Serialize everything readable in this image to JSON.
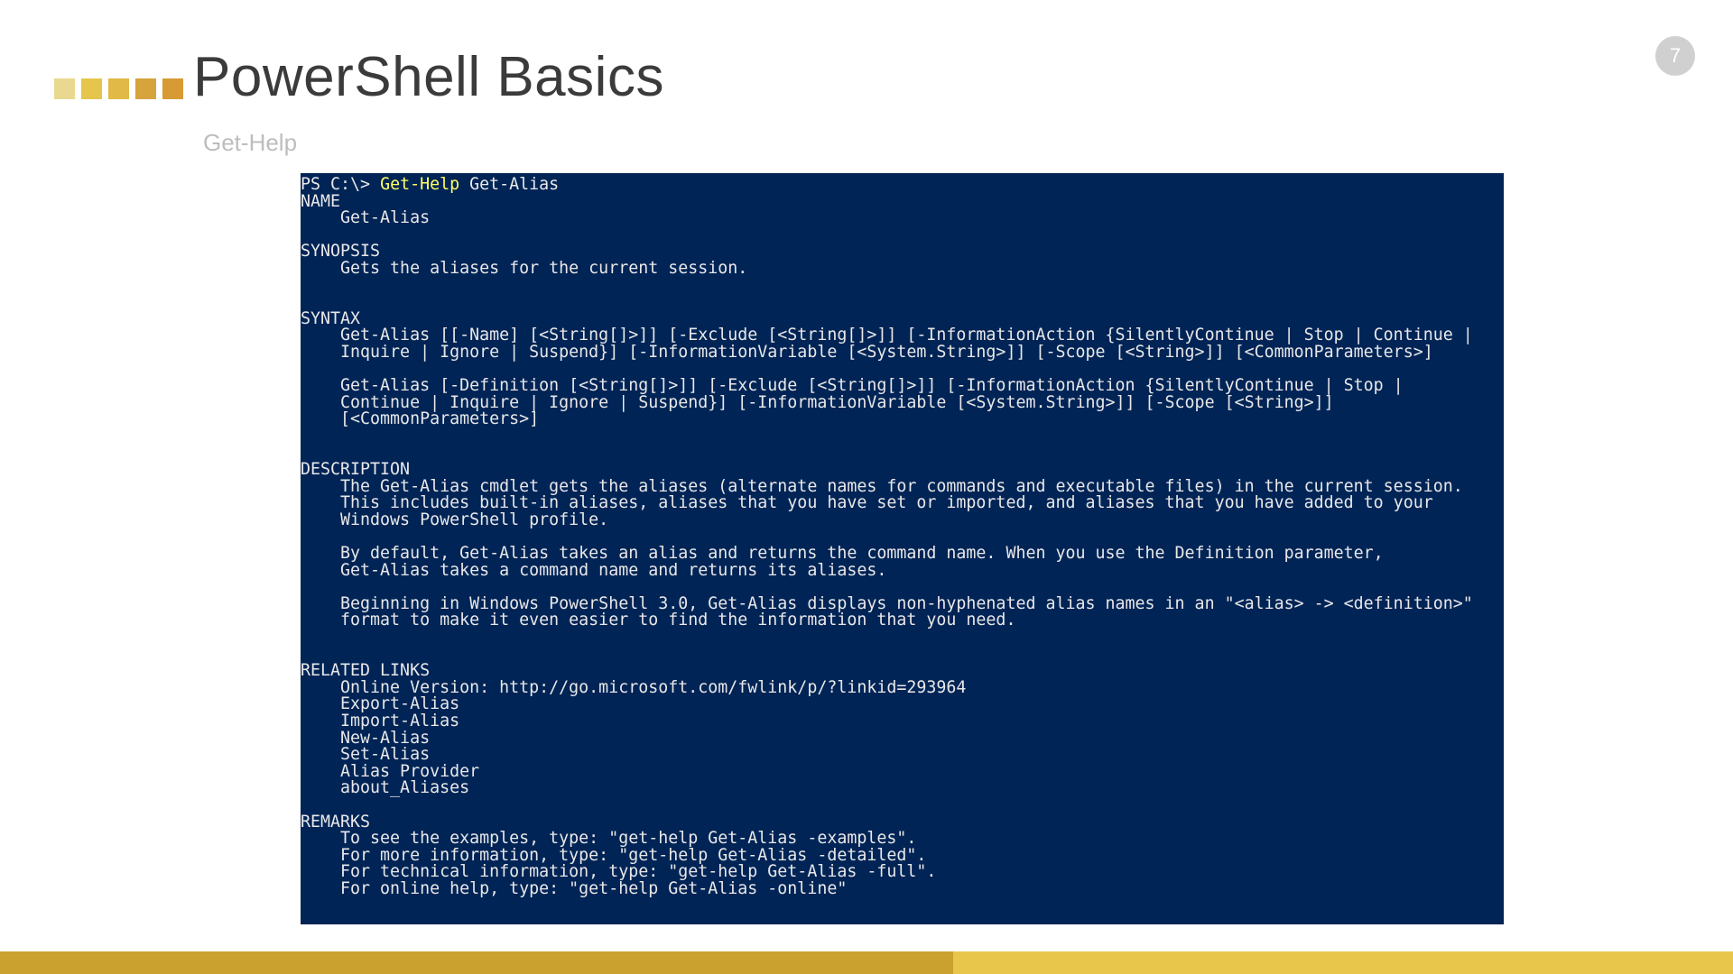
{
  "page_number": "7",
  "title": "PowerShell Basics",
  "subtitle": "Get-Help",
  "console": {
    "prompt_prefix": "PS C:\\> ",
    "command": "Get-Help",
    "argument": " Get-Alias",
    "body": "\nNAME\n    Get-Alias\n\nSYNOPSIS\n    Gets the aliases for the current session.\n\n\nSYNTAX\n    Get-Alias [[-Name] [<String[]>]] [-Exclude [<String[]>]] [-InformationAction {SilentlyContinue | Stop | Continue |\n    Inquire | Ignore | Suspend}] [-InformationVariable [<System.String>]] [-Scope [<String>]] [<CommonParameters>]\n\n    Get-Alias [-Definition [<String[]>]] [-Exclude [<String[]>]] [-InformationAction {SilentlyContinue | Stop |\n    Continue | Inquire | Ignore | Suspend}] [-InformationVariable [<System.String>]] [-Scope [<String>]]\n    [<CommonParameters>]\n\n\nDESCRIPTION\n    The Get-Alias cmdlet gets the aliases (alternate names for commands and executable files) in the current session.\n    This includes built-in aliases, aliases that you have set or imported, and aliases that you have added to your\n    Windows PowerShell profile.\n\n    By default, Get-Alias takes an alias and returns the command name. When you use the Definition parameter,\n    Get-Alias takes a command name and returns its aliases.\n\n    Beginning in Windows PowerShell 3.0, Get-Alias displays non-hyphenated alias names in an \"<alias> -> <definition>\"\n    format to make it even easier to find the information that you need.\n\n\nRELATED LINKS\n    Online Version: http://go.microsoft.com/fwlink/p/?linkid=293964\n    Export-Alias\n    Import-Alias\n    New-Alias\n    Set-Alias\n    Alias Provider\n    about_Aliases\n\nREMARKS\n    To see the examples, type: \"get-help Get-Alias -examples\".\n    For more information, type: \"get-help Get-Alias -detailed\".\n    For technical information, type: \"get-help Get-Alias -full\".\n    For online help, type: \"get-help Get-Alias -online\""
  }
}
